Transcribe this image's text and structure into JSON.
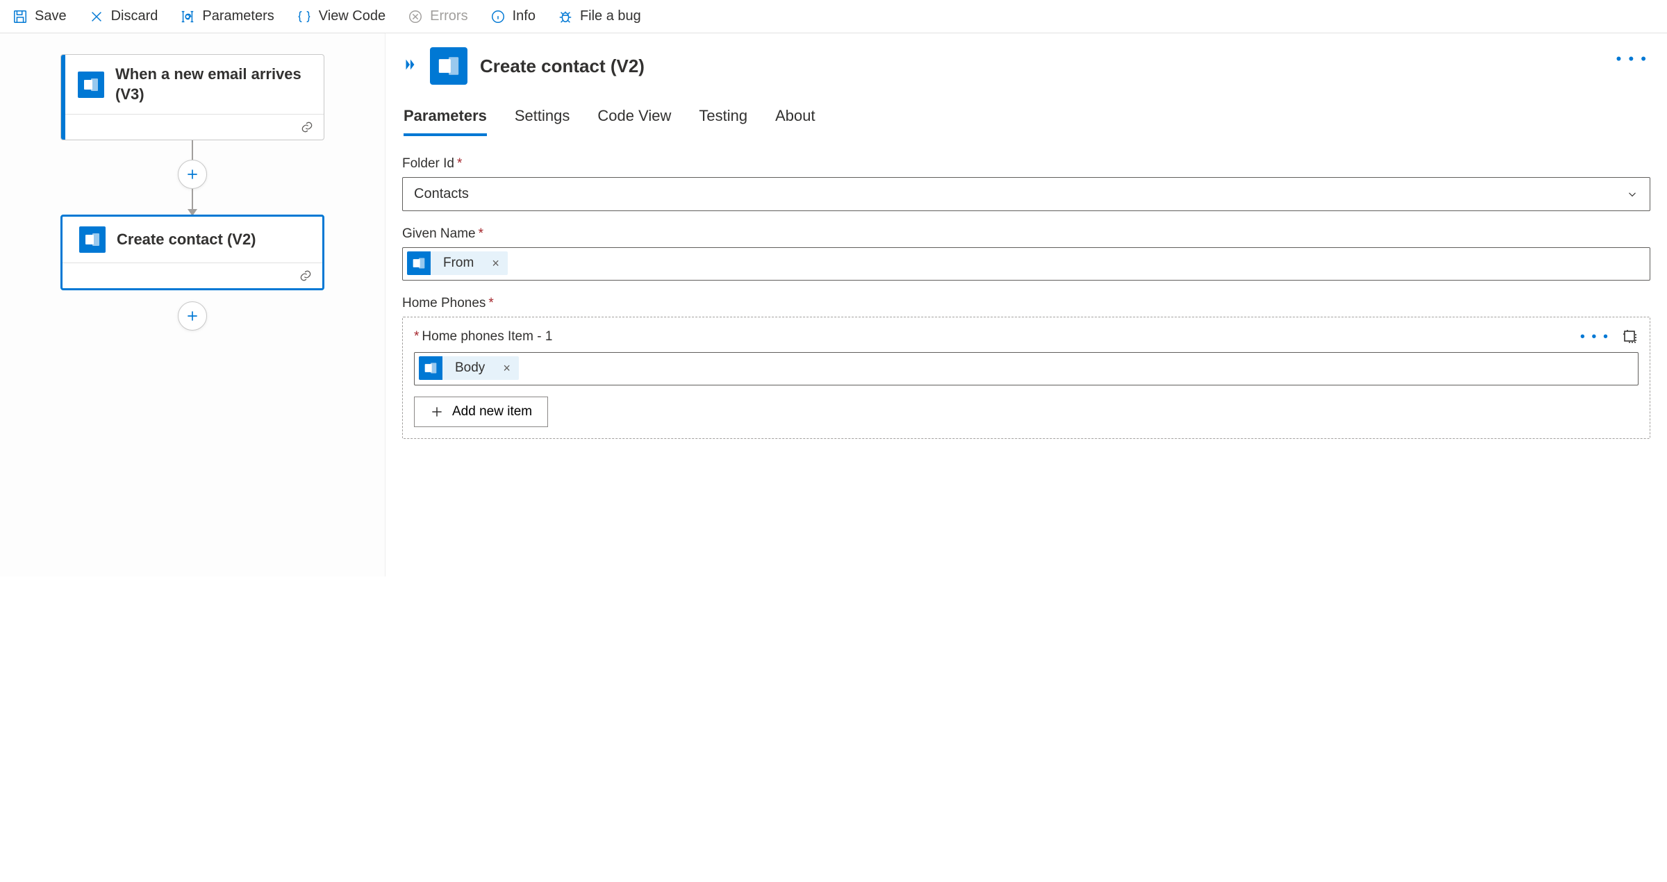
{
  "toolbar": {
    "save": "Save",
    "discard": "Discard",
    "parameters": "Parameters",
    "viewCode": "View Code",
    "errors": "Errors",
    "info": "Info",
    "fileBug": "File a bug"
  },
  "canvas": {
    "trigger": {
      "title": "When a new email arrives (V3)"
    },
    "action": {
      "title": "Create contact (V2)"
    }
  },
  "panel": {
    "title": "Create contact (V2)",
    "tabs": {
      "parameters": "Parameters",
      "settings": "Settings",
      "codeView": "Code View",
      "testing": "Testing",
      "about": "About"
    },
    "fields": {
      "folderId": {
        "label": "Folder Id",
        "value": "Contacts"
      },
      "givenName": {
        "label": "Given Name",
        "token": "From"
      },
      "homePhones": {
        "label": "Home Phones",
        "itemLabel": "Home phones Item - 1",
        "token": "Body",
        "addNew": "Add new item"
      }
    }
  }
}
